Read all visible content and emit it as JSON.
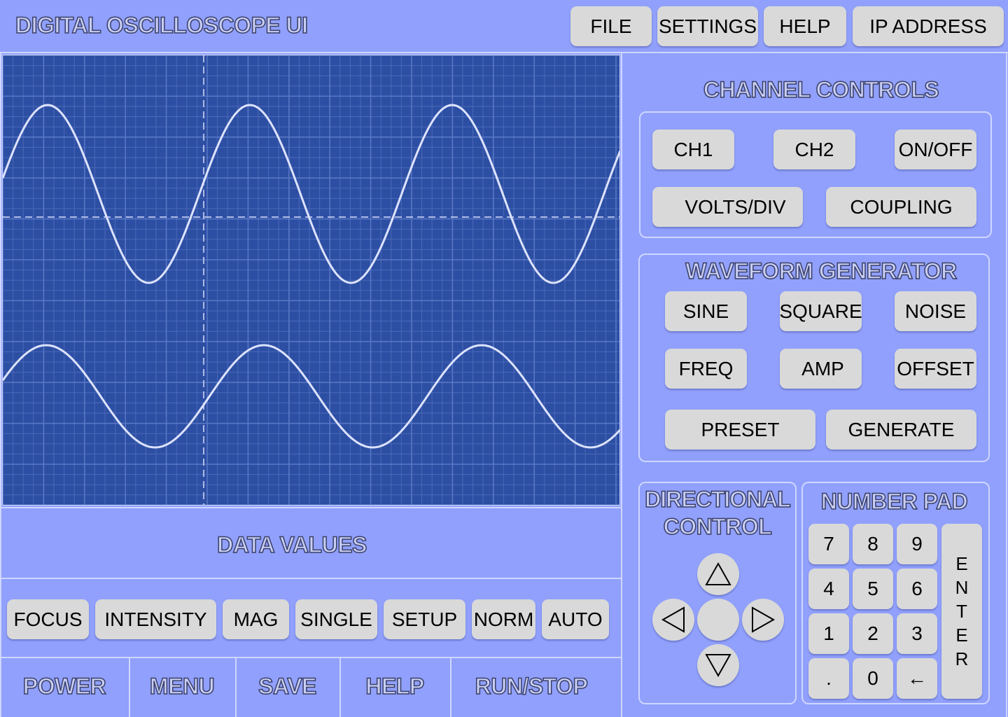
{
  "header": {
    "title": "DIGITAL OSCILLOSCOPE UI",
    "menu": {
      "file": "FILE",
      "settings": "SETTINGS",
      "help": "HELP",
      "ip_address": "IP ADDRESS"
    }
  },
  "display": {
    "data_values_label": "DATA VALUES"
  },
  "toolbar": {
    "focus": "FOCUS",
    "intensity": "INTENSITY",
    "mag": "MAG",
    "single": "SINGLE",
    "setup": "SETUP",
    "norm": "NORM",
    "auto": "AUTO"
  },
  "bottom": {
    "power": "POWER",
    "menu": "MENU",
    "save": "SAVE",
    "help": "HELP",
    "run_stop": "RUN/STOP"
  },
  "channel_controls": {
    "title": "CHANNEL CONTROLS",
    "ch1": "CH1",
    "ch2": "CH2",
    "on_off": "ON/OFF",
    "volts_div": "VOLTS/DIV",
    "coupling": "COUPLING"
  },
  "waveform_generator": {
    "title": "WAVEFORM GENERATOR",
    "sine": "SINE",
    "square": "SQUARE",
    "noise": "NOISE",
    "freq": "FREQ",
    "amp": "AMP",
    "offset": "OFFSET",
    "preset": "PRESET",
    "generate": "GENERATE"
  },
  "directional": {
    "title_line1": "DIRECTIONAL",
    "title_line2": "CONTROL",
    "icons": [
      "triangle-up-icon",
      "triangle-left-icon",
      "triangle-right-icon",
      "triangle-down-icon"
    ]
  },
  "number_pad": {
    "title": "NUMBER PAD",
    "keys": [
      "7",
      "8",
      "9",
      "4",
      "5",
      "6",
      "1",
      "2",
      "3",
      ".",
      "0",
      "←"
    ],
    "enter": [
      "E",
      "N",
      "T",
      "E",
      "R"
    ]
  },
  "colors": {
    "background": "#90a0fc",
    "screen": "#2d4fa3",
    "button": "#d9d9d9",
    "trace": "#dde3ff"
  }
}
